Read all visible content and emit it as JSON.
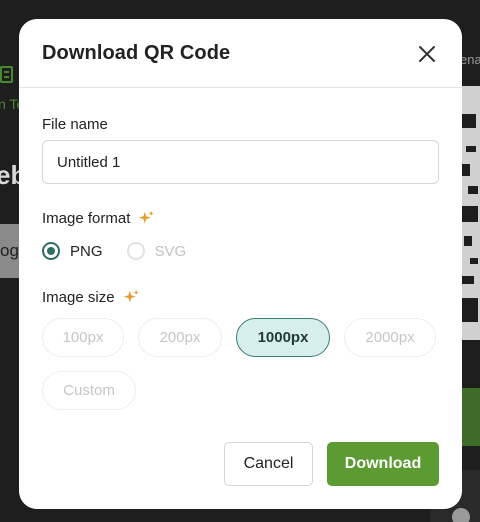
{
  "background": {
    "left_text": "n Te",
    "left_heading": "eb",
    "left_box_text": "og",
    "right_text": "ena"
  },
  "dialog": {
    "title": "Download QR Code",
    "close_icon": "close-icon",
    "file_name": {
      "label": "File name",
      "value": "Untitled 1"
    },
    "image_format": {
      "label": "Image format",
      "icon": "sparkle-icon",
      "options": [
        {
          "label": "PNG",
          "selected": true,
          "disabled": false
        },
        {
          "label": "SVG",
          "selected": false,
          "disabled": true
        }
      ]
    },
    "image_size": {
      "label": "Image size",
      "icon": "sparkle-icon",
      "options": [
        {
          "label": "100px",
          "selected": false
        },
        {
          "label": "200px",
          "selected": false
        },
        {
          "label": "1000px",
          "selected": true
        },
        {
          "label": "2000px",
          "selected": false
        },
        {
          "label": "Custom",
          "selected": false
        }
      ]
    },
    "actions": {
      "cancel_label": "Cancel",
      "download_label": "Download"
    }
  },
  "colors": {
    "accent_teal": "#2e6d66",
    "selected_fill": "#d7efec",
    "download_green": "#5b9b32",
    "sparkle_orange": "#e89a2a"
  }
}
